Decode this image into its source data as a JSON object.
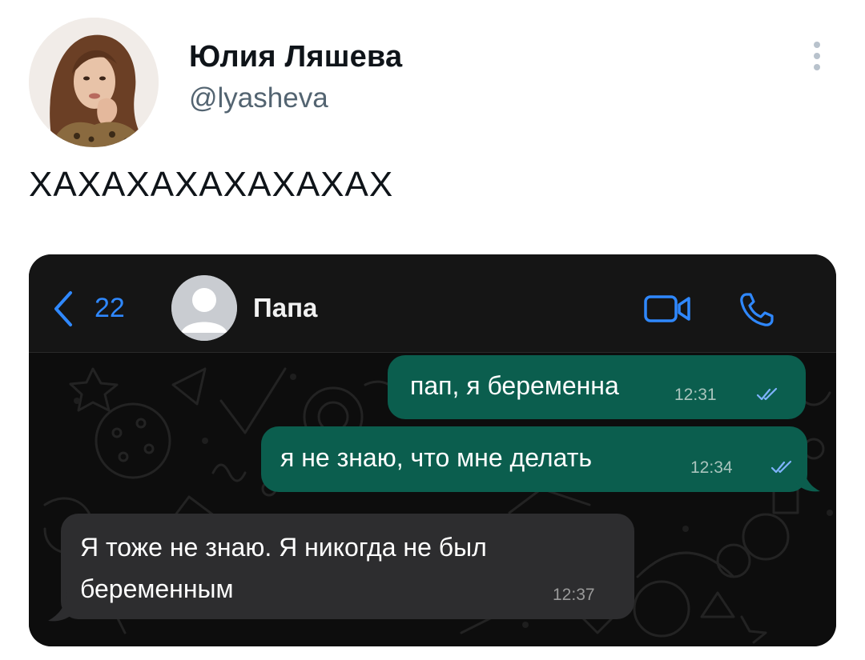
{
  "tweet": {
    "author_name": "Юлия Ляшева",
    "author_handle": "@lyasheva",
    "text": "ХАХАХАХАХАХАХАХ",
    "more_icon": "more-vertical-icon"
  },
  "chat": {
    "back_count": "22",
    "contact_name": "Папа",
    "accent_color": "#2f88ff",
    "outgoing_color": "#0b5e4e",
    "incoming_color": "#2d2d2f",
    "icons": [
      "chevron-left-icon",
      "contact-avatar-icon",
      "video-call-icon",
      "phone-icon",
      "double-check-icon"
    ],
    "messages": [
      {
        "direction": "outgoing",
        "text": "пап, я беременна",
        "time": "12:31",
        "status": "read"
      },
      {
        "direction": "outgoing",
        "text": "я не знаю, что мне делать",
        "time": "12:34",
        "status": "read"
      },
      {
        "direction": "incoming",
        "text": "Я тоже не знаю.  Я никогда не был беременным",
        "time": "12:37"
      }
    ]
  }
}
